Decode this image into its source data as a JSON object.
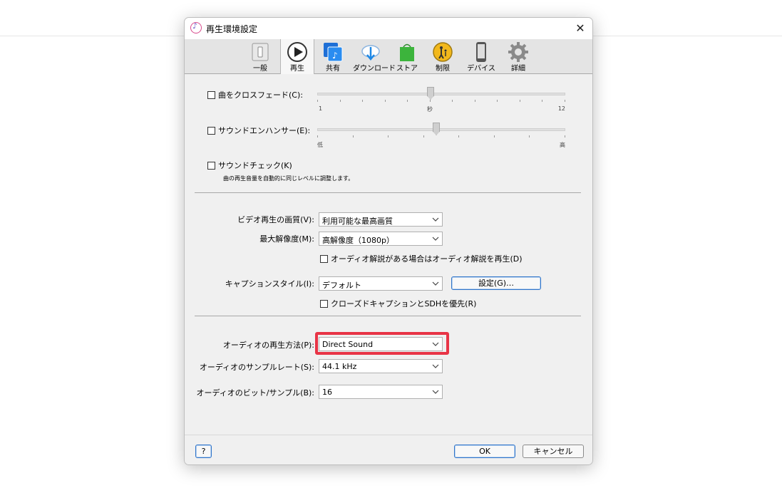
{
  "window": {
    "title": "再生環境設定"
  },
  "toolbar": {
    "tabs": [
      {
        "id": "general",
        "label": "一般",
        "icon": "switch-icon"
      },
      {
        "id": "playback",
        "label": "再生",
        "icon": "play-icon"
      },
      {
        "id": "sharing",
        "label": "共有",
        "icon": "music-share-icon"
      },
      {
        "id": "download",
        "label": "ダウンロード",
        "icon": "cloud-download-icon"
      },
      {
        "id": "store",
        "label": "ストア",
        "icon": "shopping-bag-icon"
      },
      {
        "id": "restrictions",
        "label": "制限",
        "icon": "parental-icon"
      },
      {
        "id": "devices",
        "label": "デバイス",
        "icon": "phone-icon"
      },
      {
        "id": "advanced",
        "label": "詳細",
        "icon": "gear-icon"
      }
    ],
    "active": "playback"
  },
  "crossfade": {
    "label": "曲をクロスフェード(C):",
    "checked": false,
    "min_label": "1",
    "mid_label": "秒",
    "max_label": "12",
    "value": 6
  },
  "enhancer": {
    "label": "サウンドエンハンサー(E):",
    "checked": false,
    "min_label": "低",
    "max_label": "高",
    "value": 0.48
  },
  "soundcheck": {
    "label": "サウンドチェック(K)",
    "checked": false,
    "description": "曲の再生音量を自動的に同じレベルに調整します。"
  },
  "video": {
    "quality_label": "ビデオ再生の画質(V):",
    "quality_value": "利用可能な最高画質",
    "resolution_label": "最大解像度(M):",
    "resolution_value": "高解像度（1080p）",
    "audio_description_label": "オーディオ解説がある場合はオーディオ解説を再生(D)"
  },
  "caption": {
    "style_label": "キャプションスタイル(I):",
    "style_value": "デフォルト",
    "settings_button": "設定(G)…",
    "sdh_label": "クローズドキャプションとSDHを優先(R)"
  },
  "audio": {
    "playback_label": "オーディオの再生方法(P):",
    "playback_value": "Direct Sound",
    "samplerate_label": "オーディオのサンプルレート(S):",
    "samplerate_value": "44.1 kHz",
    "bits_label": "オーディオのビット/サンプル(B):",
    "bits_value": "16"
  },
  "footer": {
    "help": "?",
    "ok": "OK",
    "cancel": "キャンセル"
  },
  "colors": {
    "highlight": "#e83446",
    "primary_border": "#2f74c9"
  }
}
